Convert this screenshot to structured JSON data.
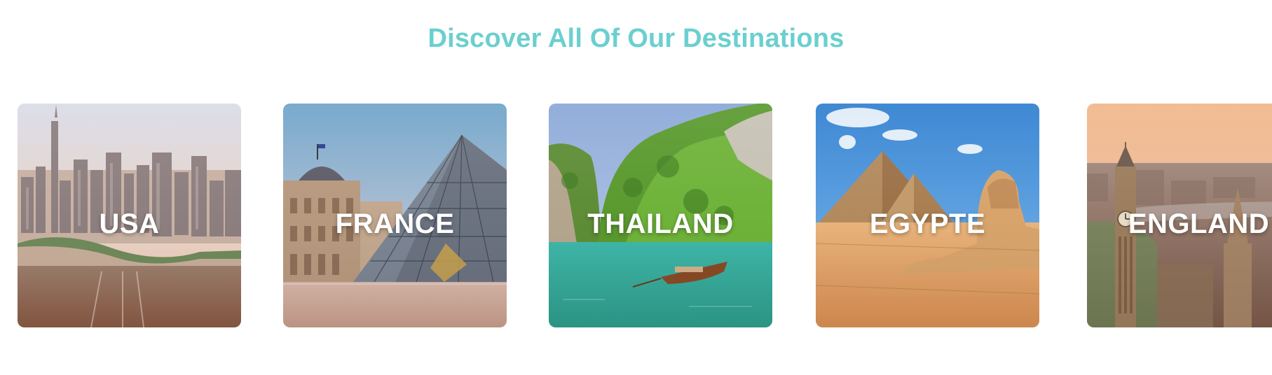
{
  "section": {
    "title": "Discover All Of Our Destinations"
  },
  "destinations": [
    {
      "name": "USA",
      "image": "new-york-skyline-image"
    },
    {
      "name": "FRANCE",
      "image": "louvre-pyramid-image"
    },
    {
      "name": "THAILAND",
      "image": "thai-island-boat-image"
    },
    {
      "name": "EGYPTE",
      "image": "pyramids-sphinx-image"
    },
    {
      "name": "ENGLAND",
      "image": "big-ben-london-image"
    }
  ],
  "colors": {
    "title": "#6ccfcf",
    "label": "#ffffff",
    "background": "#ffffff"
  }
}
